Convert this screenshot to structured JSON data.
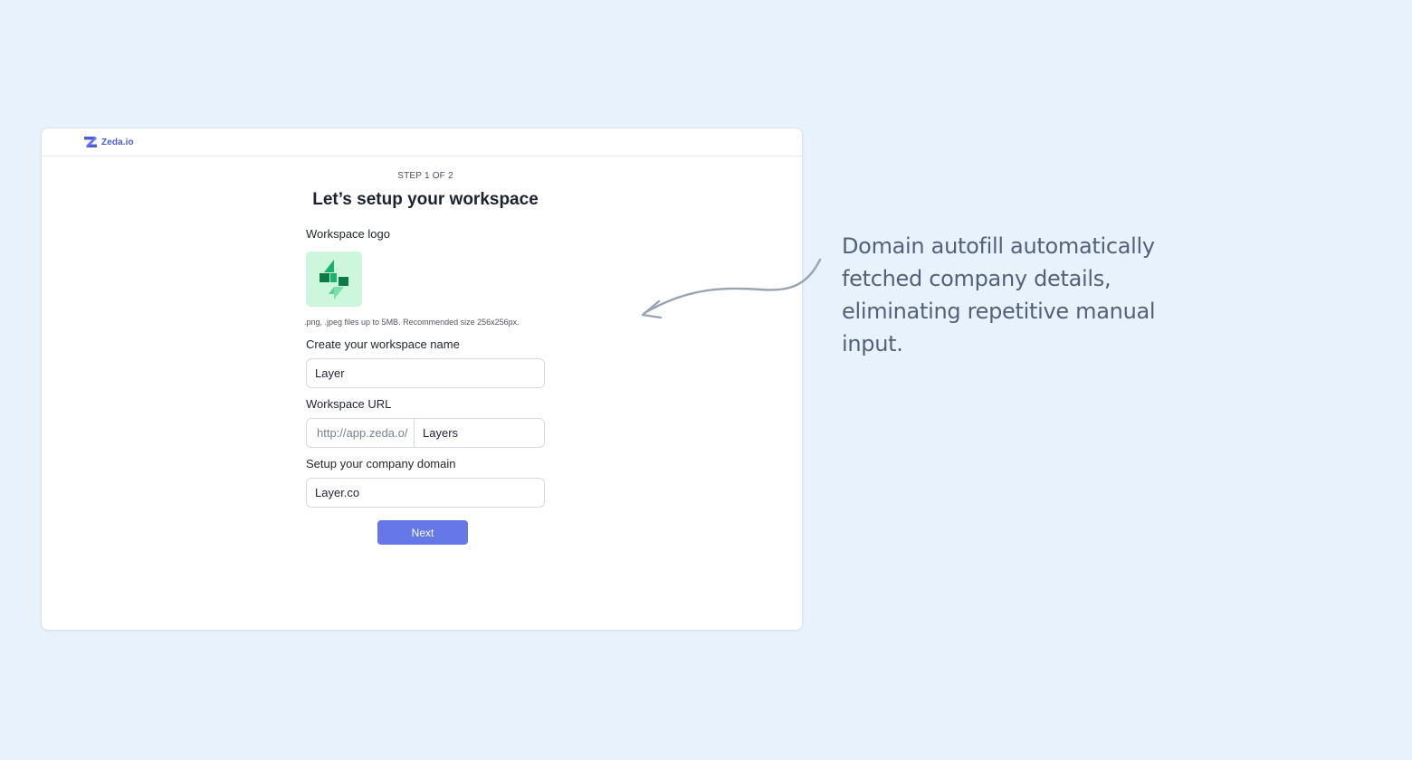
{
  "brand": {
    "name": "Zeda.io"
  },
  "colors": {
    "background": "#e8f2fd",
    "accent": "#6677e8",
    "brand": "#4b5bd6",
    "logo_bg": "#cdf7dc",
    "logo_green": "#19b36b"
  },
  "form": {
    "step": "STEP 1 OF 2",
    "title": "Let’s setup your workspace",
    "logo_label": "Workspace logo",
    "logo_hint": ".png, .jpeg files up to 5MB. Recommended size 256x256px.",
    "name_label": "Create your workspace name",
    "name_value": "Layer",
    "url_label": "Workspace URL",
    "url_prefix": "http://app.zeda.o/",
    "url_value": "Layers",
    "domain_label": "Setup your company domain",
    "domain_value": "Layer.co",
    "next_label": "Next"
  },
  "icons": {
    "brand": "zeda-logo-icon",
    "workspace_logo": "layers-logo-icon",
    "arrow": "curved-arrow-icon"
  },
  "annotation": {
    "line1": "Domain autofill automatically",
    "line2": "fetched company details,",
    "line3": "eliminating repetitive manual input."
  }
}
